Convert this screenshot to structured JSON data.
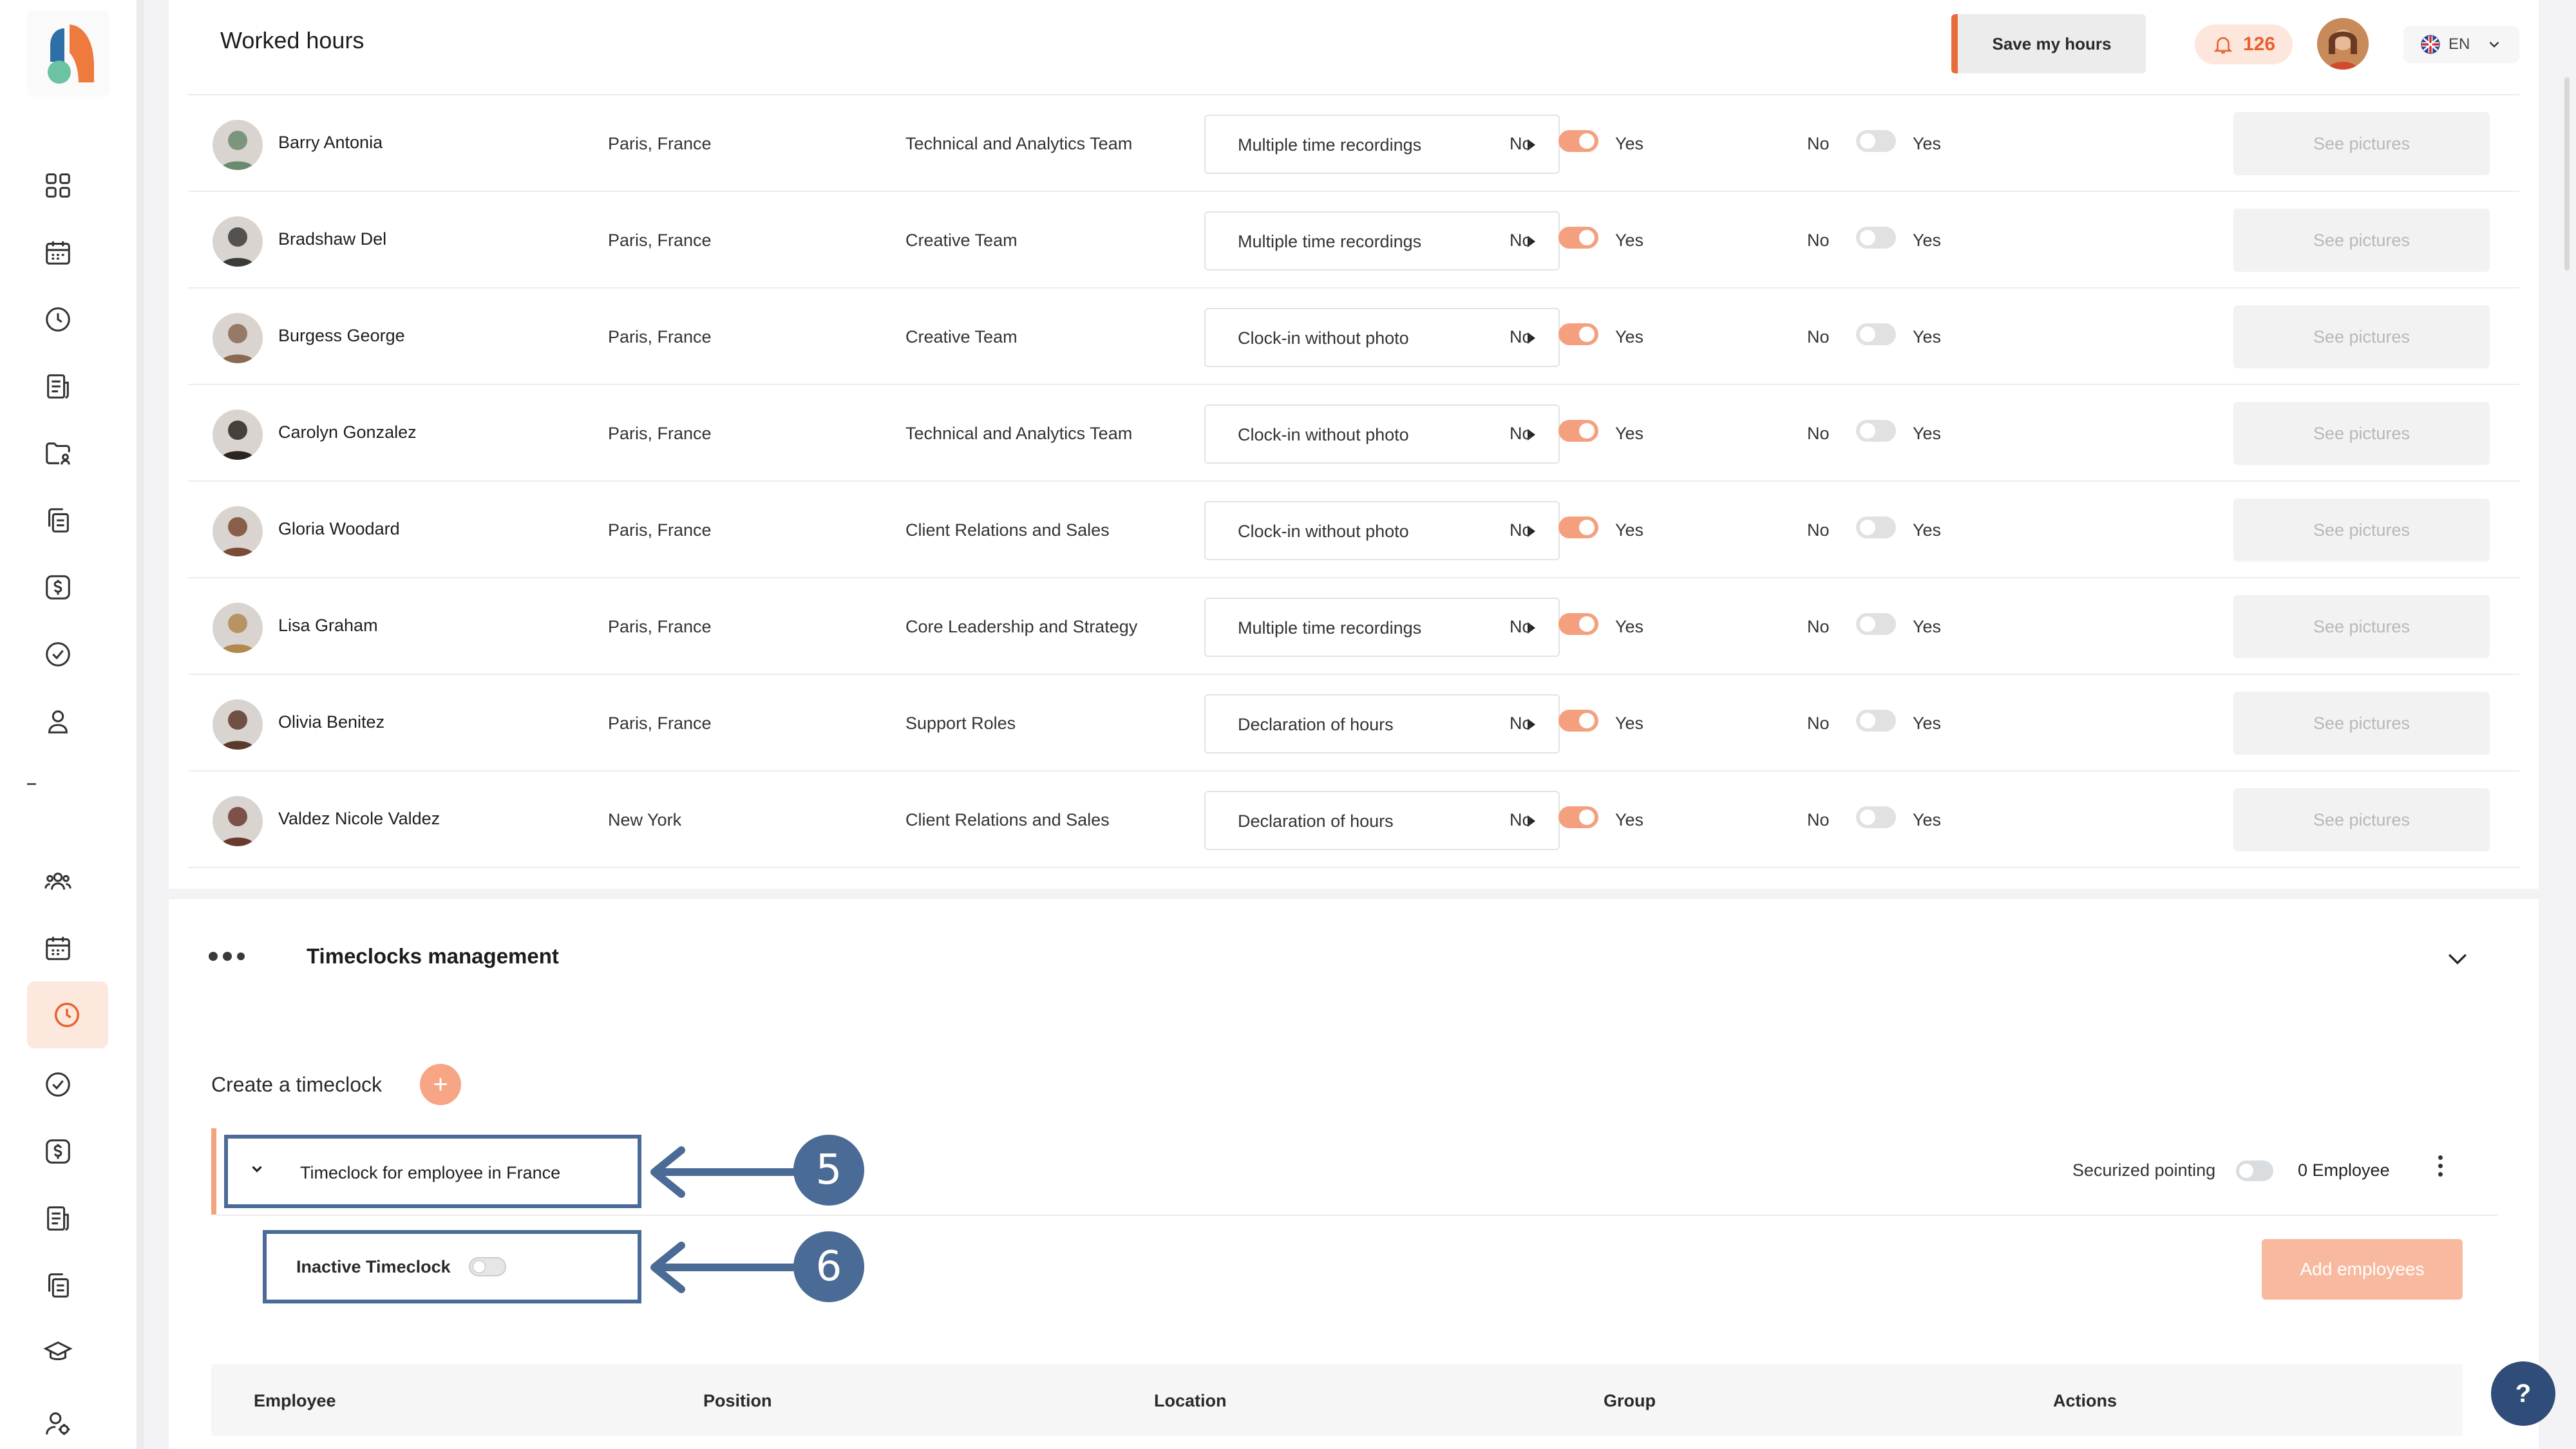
{
  "header": {
    "title": "Worked hours",
    "save_label": "Save my hours",
    "notifications_count": "126",
    "language": "EN"
  },
  "rows": [
    {
      "name": "Barry Antonia",
      "location": "Paris, France",
      "team": "Technical and Analytics Team",
      "mode": "Multiple time recordings",
      "toggle1_on": true,
      "toggle2_on": false,
      "see_label": "See pictures",
      "no": "No",
      "yes": "Yes",
      "avatar_color": "#6b8a6e"
    },
    {
      "name": "Bradshaw Del",
      "location": "Paris, France",
      "team": "Creative Team",
      "mode": "Multiple time recordings",
      "toggle1_on": true,
      "toggle2_on": false,
      "see_label": "See pictures",
      "no": "No",
      "yes": "Yes",
      "avatar_color": "#3b3b3b"
    },
    {
      "name": "Burgess George",
      "location": "Paris, France",
      "team": "Creative Team",
      "mode": "Clock-in without photo",
      "toggle1_on": true,
      "toggle2_on": false,
      "see_label": "See pictures",
      "no": "No",
      "yes": "Yes",
      "avatar_color": "#8a6a52"
    },
    {
      "name": "Carolyn Gonzalez",
      "location": "Paris, France",
      "team": "Technical and Analytics Team",
      "mode": "Clock-in without photo",
      "toggle1_on": true,
      "toggle2_on": false,
      "see_label": "See pictures",
      "no": "No",
      "yes": "Yes",
      "avatar_color": "#2c2420"
    },
    {
      "name": "Gloria Woodard",
      "location": "Paris, France",
      "team": "Client Relations and Sales",
      "mode": "Clock-in without photo",
      "toggle1_on": true,
      "toggle2_on": false,
      "see_label": "See pictures",
      "no": "No",
      "yes": "Yes",
      "avatar_color": "#7a4a34"
    },
    {
      "name": "Lisa Graham",
      "location": "Paris, France",
      "team": "Core Leadership and Strategy",
      "mode": "Multiple time recordings",
      "toggle1_on": true,
      "toggle2_on": false,
      "see_label": "See pictures",
      "no": "No",
      "yes": "Yes",
      "avatar_color": "#b08850"
    },
    {
      "name": "Olivia Benitez",
      "location": "Paris, France",
      "team": "Support Roles",
      "mode": "Declaration of hours",
      "toggle1_on": true,
      "toggle2_on": false,
      "see_label": "See pictures",
      "no": "No",
      "yes": "Yes",
      "avatar_color": "#5a3a2a"
    },
    {
      "name": "Valdez Nicole Valdez",
      "location": "New York",
      "team": "Client Relations and Sales",
      "mode": "Declaration of hours",
      "toggle1_on": true,
      "toggle2_on": false,
      "see_label": "See pictures",
      "no": "No",
      "yes": "Yes",
      "avatar_color": "#6a3a30"
    }
  ],
  "timeclocks": {
    "title": "Timeclocks management",
    "create_label": "Create a timeclock",
    "plus": "+",
    "item_name": "Timeclock for employee in France",
    "securized_label": "Securized pointing",
    "employee_count": "0 Employee",
    "inactive_label": "Inactive Timeclock",
    "add_employees_label": "Add employees",
    "columns": [
      "Employee",
      "Position",
      "Location",
      "Group",
      "Actions"
    ]
  },
  "annotations": {
    "step1": "5",
    "step2": "6"
  },
  "help": "?",
  "colors": {
    "accent": "#e96a3a",
    "toggle_on": "#f4a07f",
    "annotation": "#4a6b95"
  }
}
